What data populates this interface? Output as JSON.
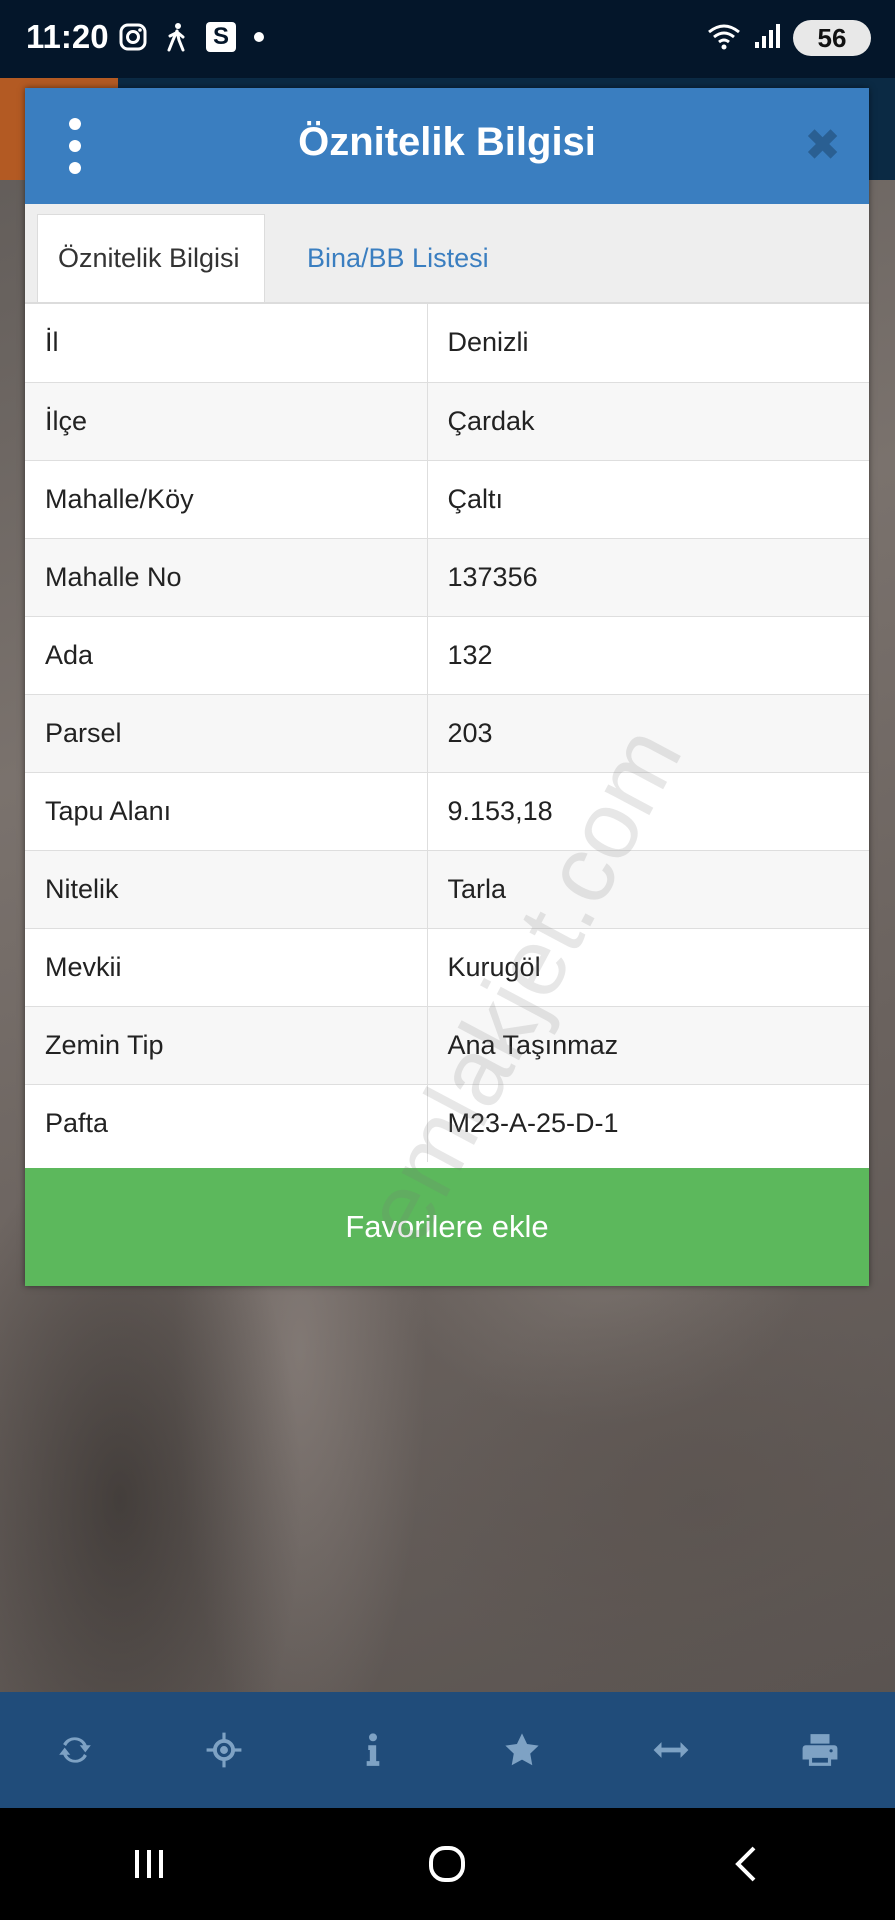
{
  "status": {
    "time": "11:20",
    "battery": "56",
    "left_icons": [
      "instagram-icon",
      "walking-icon",
      "s-app-icon",
      "dot-icon"
    ],
    "right_icons": [
      "wifi-icon",
      "signal-icon",
      "battery-icon"
    ]
  },
  "modal": {
    "title": "Öznitelik Bilgisi",
    "tabs": [
      {
        "label": "Öznitelik Bilgisi",
        "active": true
      },
      {
        "label": "Bina/BB Listesi",
        "active": false
      }
    ],
    "rows": [
      {
        "key": "İl",
        "value": "Denizli"
      },
      {
        "key": "İlçe",
        "value": "Çardak"
      },
      {
        "key": "Mahalle/Köy",
        "value": "Çaltı"
      },
      {
        "key": "Mahalle No",
        "value": "137356"
      },
      {
        "key": "Ada",
        "value": "132"
      },
      {
        "key": "Parsel",
        "value": "203"
      },
      {
        "key": "Tapu Alanı",
        "value": "9.153,18"
      },
      {
        "key": "Nitelik",
        "value": "Tarla"
      },
      {
        "key": "Mevkii",
        "value": "Kurugöl"
      },
      {
        "key": "Zemin Tip",
        "value": "Ana Taşınmaz"
      },
      {
        "key": "Pafta",
        "value": "M23-A-25-D-1"
      }
    ],
    "favorite_label": "Favorilere ekle",
    "watermark": "emlakjet.com"
  },
  "toolbar": {
    "items": [
      "refresh-icon",
      "locate-icon",
      "info-icon",
      "star-icon",
      "measure-icon",
      "print-icon"
    ]
  },
  "colors": {
    "header": "#3a7ec0",
    "favorite": "#5cb85c",
    "toolbar": "#204c7a"
  }
}
